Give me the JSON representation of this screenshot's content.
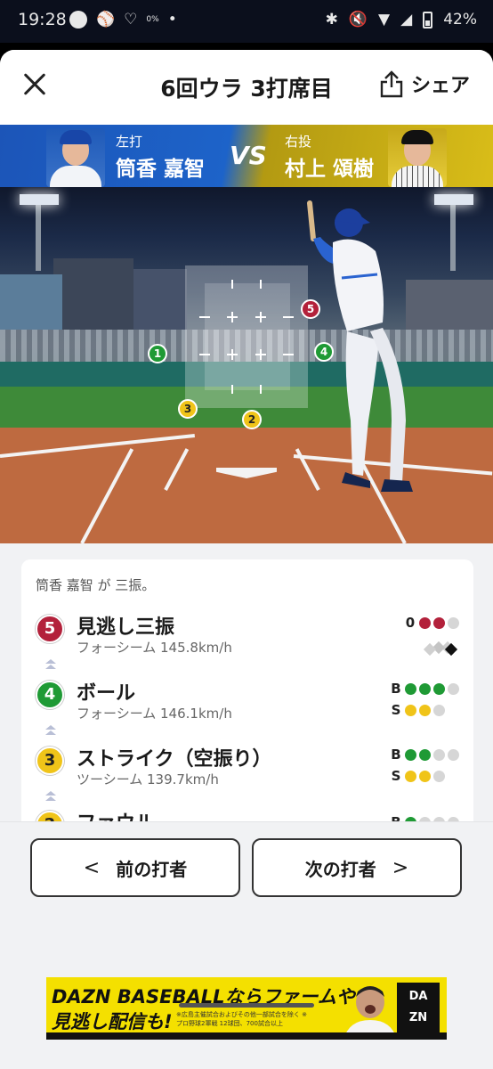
{
  "status_bar": {
    "time": "19:28",
    "data_saver_label": "0%",
    "battery": "42%"
  },
  "header": {
    "title": "6回ウラ 3打席目",
    "share_label": "シェア"
  },
  "matchup": {
    "batter": {
      "role": "左打",
      "name": "筒香 嘉智"
    },
    "vs": "VS",
    "pitcher": {
      "role": "右投",
      "name": "村上 頌樹"
    }
  },
  "field": {
    "markers": [
      {
        "num": "5",
        "color": "#b3213b"
      },
      {
        "num": "1",
        "color": "#1f9a35"
      },
      {
        "num": "4",
        "color": "#1f9a35"
      },
      {
        "num": "3",
        "color": "#f0c419"
      },
      {
        "num": "2",
        "color": "#f0c419"
      }
    ]
  },
  "play": {
    "summary": "筒香 嘉智 が 三振。",
    "pitches": [
      {
        "num": "5",
        "color": "#b3213b",
        "result": "見逃し三振",
        "detail": "フォーシーム 145.8km/h",
        "outs_label": "0",
        "outs": [
          "r",
          "r",
          "n"
        ]
      },
      {
        "num": "4",
        "color": "#1f9a35",
        "result": "ボール",
        "detail": "フォーシーム 146.1km/h",
        "balls": [
          "g",
          "g",
          "g",
          "n"
        ],
        "strikes": [
          "y",
          "y",
          "n"
        ]
      },
      {
        "num": "3",
        "color": "#f0c419",
        "result": "ストライク（空振り）",
        "detail": "ツーシーム 139.7km/h",
        "balls": [
          "g",
          "g",
          "n",
          "n"
        ],
        "strikes": [
          "y",
          "y",
          "n"
        ]
      },
      {
        "num": "2",
        "color": "#f0c419",
        "result": "ファウル",
        "detail": "",
        "balls": [
          "g",
          "n",
          "n",
          "n"
        ],
        "strikes": []
      }
    ],
    "ball_label": "B",
    "strike_label": "S"
  },
  "navigation": {
    "prev_label": "前の打者",
    "next_label": "次の打者",
    "prev_arrow": "<",
    "next_arrow": ">"
  },
  "ad": {
    "line1": "DAZN BASEBALLならファームや",
    "line2": "見逃し配信も!",
    "note": "※広島主催試合およびその他一部試合を除く ※プロ野球2軍戦 12球団、700試合以上",
    "logo_top": "DA",
    "logo_bottom": "ZN"
  }
}
